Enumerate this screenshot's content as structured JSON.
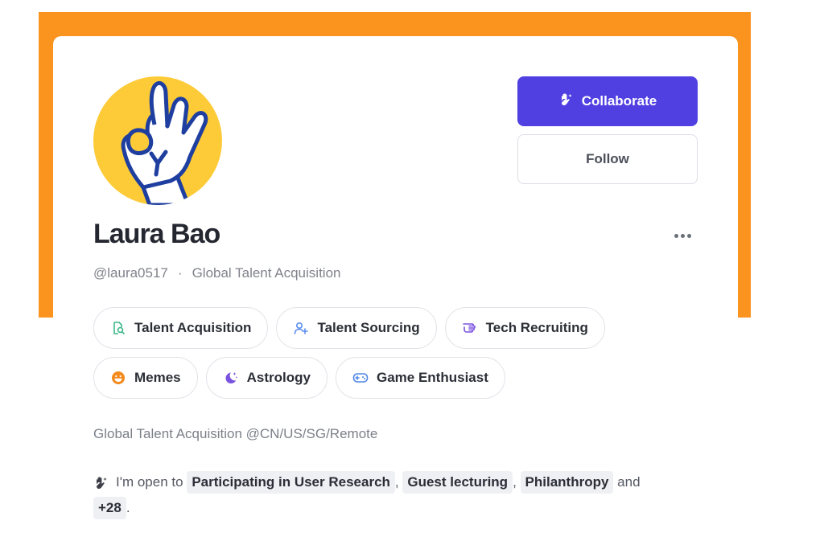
{
  "profile": {
    "name": "Laura Bao",
    "handle": "@laura0517",
    "separator": "·",
    "headline": "Global Talent Acquisition",
    "bio": "Global Talent Acquisition @CN/US/SG/Remote"
  },
  "actions": {
    "collaborate_label": "Collaborate",
    "follow_label": "Follow",
    "more_icon": "more-horizontal-icon"
  },
  "tags": [
    [
      {
        "label": "Talent Acquisition",
        "icon": "document-search-icon",
        "color": "#3cb88a"
      },
      {
        "label": "Talent Sourcing",
        "icon": "user-add-icon",
        "color": "#5b8def"
      },
      {
        "label": "Tech Recruiting",
        "icon": "hand-point-icon",
        "color": "#7a52e0"
      }
    ],
    [
      {
        "label": "Memes",
        "icon": "grin-face-icon",
        "color": "#f28a1c"
      },
      {
        "label": "Astrology",
        "icon": "moon-stars-icon",
        "color": "#7a52e0"
      },
      {
        "label": "Game Enthusiast",
        "icon": "gamepad-icon",
        "color": "#4f86e8"
      }
    ]
  ],
  "open_to": {
    "prefix": "I'm open to",
    "items": [
      "Participating in User Research",
      "Guest lecturing",
      "Philanthropy"
    ],
    "sep1": ",",
    "sep2": ",",
    "conjunction": "and",
    "more": "+28",
    "suffix": "."
  },
  "colors": {
    "banner": "#fb931f",
    "primary": "#5040e2",
    "avatar_bg": "#fccb37"
  }
}
